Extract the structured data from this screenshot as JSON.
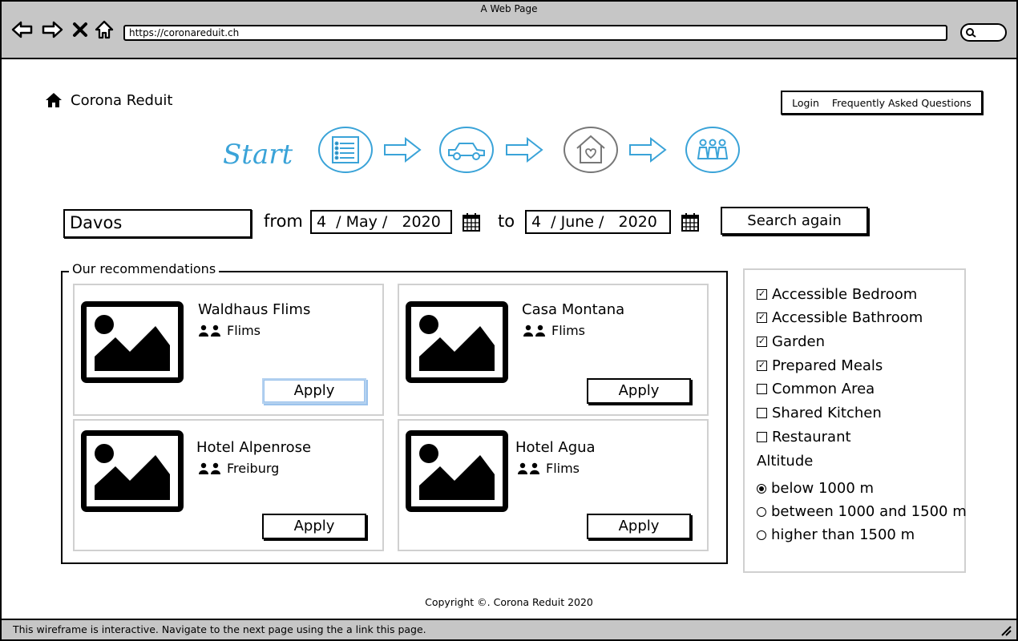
{
  "browser": {
    "window_title": "A Web Page",
    "url": "https://coronareduit.ch"
  },
  "header": {
    "logo_text": "Corona Reduit",
    "nav": [
      "Login",
      "Frequently Asked Questions"
    ]
  },
  "steps": {
    "start_label": "Start"
  },
  "search": {
    "destination": "Davos",
    "from_label": "from",
    "from_date": "4  / May /   2020",
    "to_label": "to",
    "to_date": "4  / June /   2020",
    "button": "Search again"
  },
  "recommendations": {
    "legend": "Our recommendations",
    "cards": [
      {
        "name": "Waldhaus Flims",
        "location": "Flims",
        "button": "Apply"
      },
      {
        "name": "Casa Montana",
        "location": "Flims",
        "button": "Apply"
      },
      {
        "name": "Hotel Alpenrose",
        "location": "Freiburg",
        "button": "Apply"
      },
      {
        "name": "Hotel Agua",
        "location": "Flims",
        "button": "Apply"
      }
    ]
  },
  "filters": {
    "checkboxes": [
      {
        "label": "Accessible Bedroom",
        "checked": true
      },
      {
        "label": "Accessible Bathroom",
        "checked": true
      },
      {
        "label": "Garden",
        "checked": true
      },
      {
        "label": "Prepared Meals",
        "checked": true
      },
      {
        "label": "Common Area",
        "checked": false
      },
      {
        "label": "Shared Kitchen",
        "checked": false
      },
      {
        "label": "Restaurant",
        "checked": false
      }
    ],
    "altitude_label": "Altitude",
    "altitude_options": [
      {
        "label": "below 1000 m",
        "selected": true
      },
      {
        "label": "between 1000 and 1500 m",
        "selected": false
      },
      {
        "label": "higher than 1500 m",
        "selected": false
      }
    ]
  },
  "footer": {
    "copyright": "Copyright ©. Corona Reduit 2020"
  },
  "statusbar": {
    "text": "This wireframe is interactive. Navigate to the next page using the a link this page."
  },
  "colors": {
    "chrome_gray": "#c6c6c6",
    "step_blue": "#3aa3d8",
    "step_gray": "#777777",
    "card_border": "#d0d0d0",
    "focus_blue": "#9cc3ec"
  }
}
